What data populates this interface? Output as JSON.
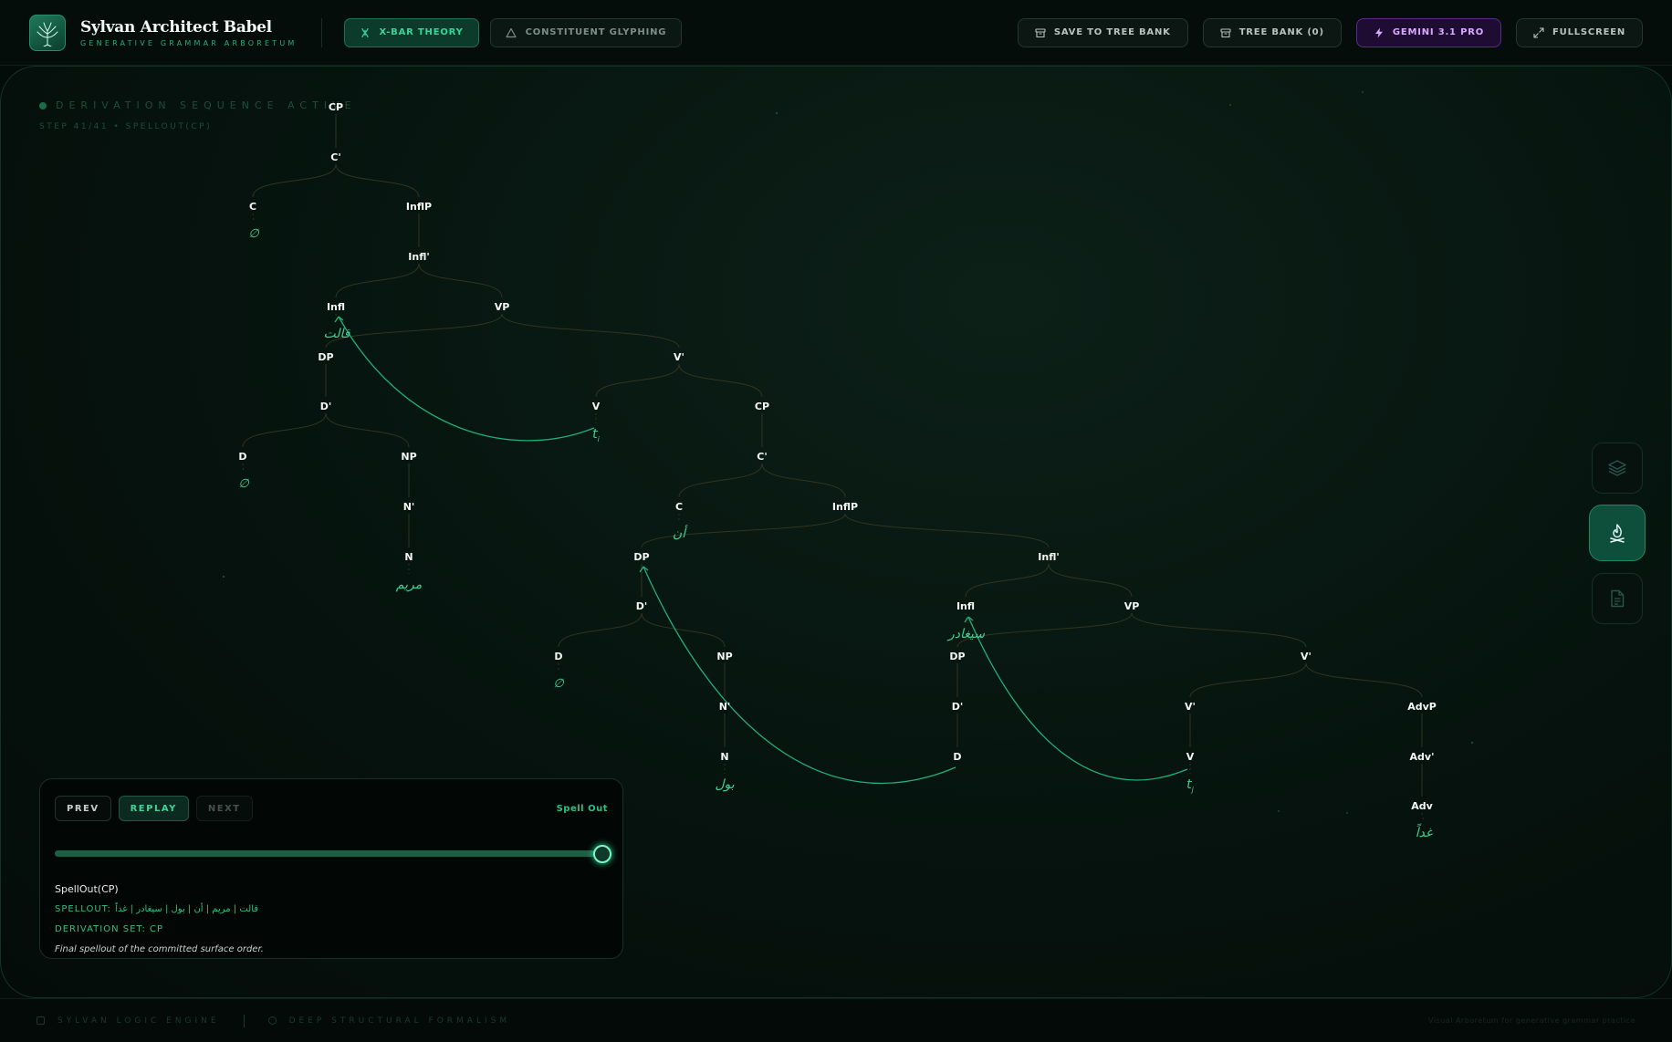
{
  "app": {
    "title": "Sylvan Architect Babel",
    "subtitle": "GENERATIVE GRAMMAR ARBORETUM"
  },
  "header": {
    "modes": [
      {
        "label": "X-BAR THEORY",
        "active": true,
        "icon": "dna-icon"
      },
      {
        "label": "CONSTITUENT GLYPHING",
        "active": false,
        "icon": "triangle-icon"
      }
    ],
    "save_label": "SAVE TO TREE BANK",
    "treebank_label": "TREE BANK (0)",
    "model_label": "GEMINI 3.1 PRO",
    "fullscreen_label": "FULLSCREEN"
  },
  "canvas": {
    "status_title": "DERIVATION SEQUENCE ACTIVE",
    "status_step": "STEP 41/41 • SPELLOUT(CP)"
  },
  "tree": {
    "nodes": [
      {
        "id": "cp1",
        "label": "CP"
      },
      {
        "id": "c1b",
        "label": "C'"
      },
      {
        "id": "c1",
        "label": "C"
      },
      {
        "id": "c1leaf",
        "label": "∅"
      },
      {
        "id": "ip1",
        "label": "InflP"
      },
      {
        "id": "i1b",
        "label": "Infl'"
      },
      {
        "id": "i1",
        "label": "Infl"
      },
      {
        "id": "i1leaf",
        "label": "قالت"
      },
      {
        "id": "vp1",
        "label": "VP"
      },
      {
        "id": "dp1",
        "label": "DP"
      },
      {
        "id": "d1b",
        "label": "D'"
      },
      {
        "id": "d1",
        "label": "D"
      },
      {
        "id": "d1leaf",
        "label": "∅"
      },
      {
        "id": "np1",
        "label": "NP"
      },
      {
        "id": "n1b",
        "label": "N'"
      },
      {
        "id": "n1",
        "label": "N"
      },
      {
        "id": "n1leaf",
        "label": "مريم"
      },
      {
        "id": "v1b",
        "label": "V'"
      },
      {
        "id": "v1",
        "label": "V"
      },
      {
        "id": "v1leaf",
        "label": "t"
      },
      {
        "id": "cp2",
        "label": "CP"
      },
      {
        "id": "c2b",
        "label": "C'"
      },
      {
        "id": "c2",
        "label": "C"
      },
      {
        "id": "c2leaf",
        "label": "أن"
      },
      {
        "id": "ip2",
        "label": "InflP"
      },
      {
        "id": "dp2",
        "label": "DP"
      },
      {
        "id": "d2b",
        "label": "D'"
      },
      {
        "id": "d2",
        "label": "D"
      },
      {
        "id": "d2leaf",
        "label": "∅"
      },
      {
        "id": "np2",
        "label": "NP"
      },
      {
        "id": "n2b",
        "label": "N'"
      },
      {
        "id": "n2",
        "label": "N"
      },
      {
        "id": "n2leaf",
        "label": "بول"
      },
      {
        "id": "i2b",
        "label": "Infl'"
      },
      {
        "id": "i2",
        "label": "Infl"
      },
      {
        "id": "i2leaf",
        "label": "سيغادر"
      },
      {
        "id": "vp2",
        "label": "VP"
      },
      {
        "id": "dp3",
        "label": "DP"
      },
      {
        "id": "d3b",
        "label": "D'"
      },
      {
        "id": "d3",
        "label": "D"
      },
      {
        "id": "v2b",
        "label": "V'"
      },
      {
        "id": "v3b",
        "label": "V'"
      },
      {
        "id": "v2",
        "label": "V"
      },
      {
        "id": "v2leaf",
        "label": "t"
      },
      {
        "id": "advp",
        "label": "AdvP"
      },
      {
        "id": "advb",
        "label": "Adv'"
      },
      {
        "id": "adv",
        "label": "Adv"
      },
      {
        "id": "advleaf",
        "label": "غداً"
      }
    ],
    "trace_index_1": "i",
    "trace_index_2": "j"
  },
  "panel": {
    "prev_label": "PREV",
    "replay_label": "REPLAY",
    "next_label": "NEXT",
    "spell_link": "Spell Out",
    "progress": 1.0,
    "step_name": "SpellOut(CP)",
    "spellout_prefix": "SPELLOUT:",
    "spellout_value": "قالت | مريم | أن | بول | سيغادر | غداً",
    "derivation_set": "DERIVATION SET: CP",
    "description": "Final spellout of the committed surface order."
  },
  "footer": {
    "engine": "SYLVAN LOGIC ENGINE",
    "formalism": "DEEP STRUCTURAL FORMALISM",
    "right_text": "Visual Arboretum for generative grammar practice"
  },
  "colors": {
    "accent": "#34d69b",
    "background": "#030c09",
    "gemini": "#d8aaff"
  }
}
